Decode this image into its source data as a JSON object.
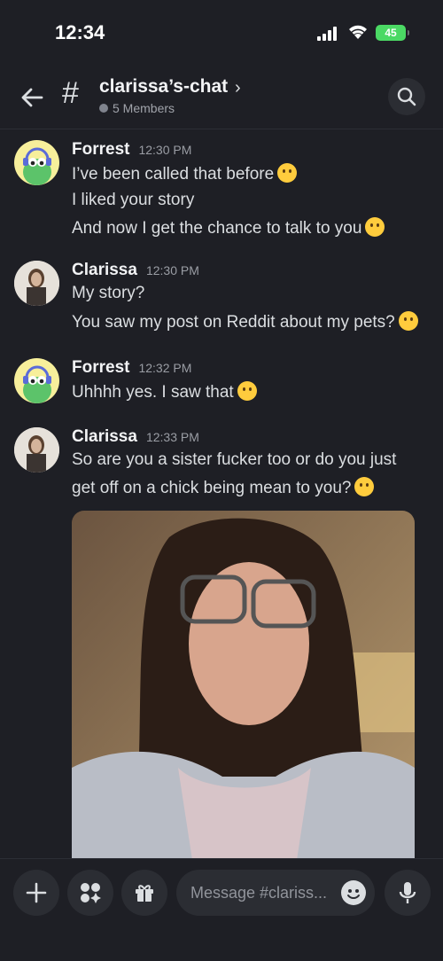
{
  "status_bar": {
    "time": "12:34",
    "battery": "45"
  },
  "header": {
    "channel_name": "clarissa’s-chat",
    "members": "5 Members"
  },
  "messages": [
    {
      "author": "Forrest",
      "time": "12:30 PM",
      "lines": [
        "I’ve been called that before",
        "I liked your story",
        "And now I get the chance to talk to you"
      ]
    },
    {
      "author": "Clarissa",
      "time": "12:30 PM",
      "lines": [
        "My story?",
        "You saw my post on Reddit about my pets?"
      ]
    },
    {
      "author": "Forrest",
      "time": "12:32 PM",
      "lines": [
        "Uhhhh yes. I saw that"
      ]
    },
    {
      "author": "Clarissa",
      "time": "12:33 PM",
      "lines": [
        "So are you a sister fucker too or do you just",
        "get off on a chick being mean to you?"
      ]
    }
  ],
  "composer": {
    "placeholder": "Message #clariss..."
  },
  "colors": {
    "background": "#1e1f25",
    "input": "#2b2d33",
    "battery": "#4bd964"
  }
}
